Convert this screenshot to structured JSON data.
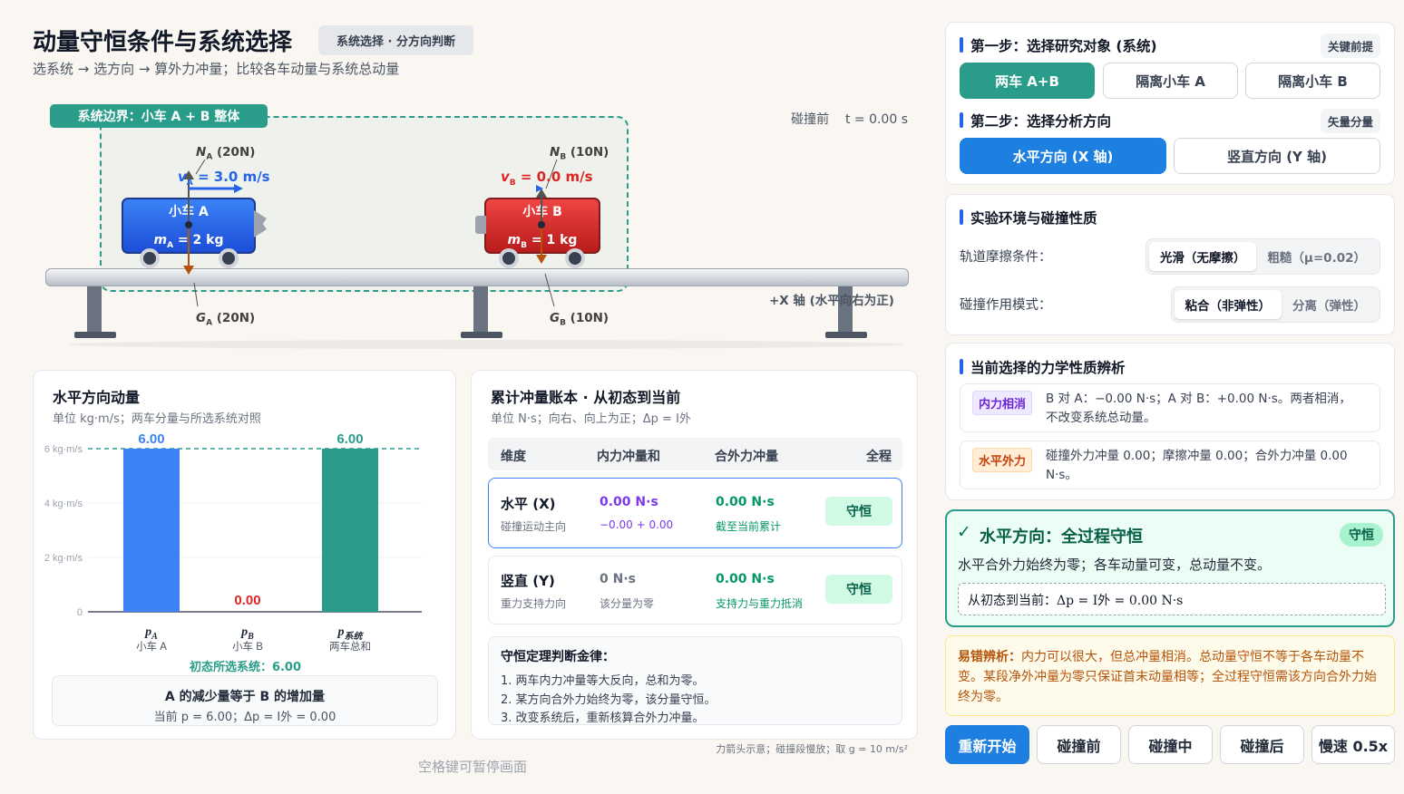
{
  "header": {
    "title": "动量守恒条件与系统选择",
    "tag": "系统选择 · 分方向判断",
    "subtitle": "选系统 → 选方向 → 算外力冲量；比较各车动量与系统总动量"
  },
  "scene": {
    "system_label": "系统边界：小车 A + B 整体",
    "status_phase": "碰撞前",
    "status_time": "t = 0.00 s",
    "cart_a": {
      "name": "小车 A",
      "mass_sym": "m",
      "mass_sub": "A",
      "mass_val": "= 2 kg",
      "vel_sym": "v",
      "vel_sub": "A",
      "vel_val": "= 3.0 m/s",
      "n_sym": "N",
      "n_sub": "A",
      "n_val": "(20N)",
      "g_sym": "G",
      "g_sub": "A",
      "g_val": "(20N)"
    },
    "cart_b": {
      "name": "小车 B",
      "mass_sym": "m",
      "mass_sub": "B",
      "mass_val": "= 1 kg",
      "vel_sym": "v",
      "vel_sub": "B",
      "vel_val": "= 0.0 m/s",
      "n_sym": "N",
      "n_sub": "B",
      "n_val": "(10N)",
      "g_sym": "G",
      "g_sub": "B",
      "g_val": "(10N)"
    },
    "axis_label": "+X 轴 (水平向右为正)"
  },
  "momentum": {
    "title": "水平方向动量",
    "subtitle": "单位 kg·m/s；两车分量与所选系统对照",
    "ref_note": "初态所选系统：6.00",
    "hint_title": "A 的减少量等于 B 的增加量",
    "hint_text": "当前 p = 6.00；Δp = I外 = 0.00",
    "chart_data": {
      "type": "bar",
      "categories": [
        {
          "sym": "p",
          "sub": "A",
          "desc": "小车 A"
        },
        {
          "sym": "p",
          "sub": "B",
          "desc": "小车 B"
        },
        {
          "sym": "p",
          "sub": "系统",
          "desc": "两车总和"
        }
      ],
      "values": [
        6.0,
        0.0,
        6.0
      ],
      "value_labels": [
        "6.00",
        "0.00",
        "6.00"
      ],
      "colors": [
        "#3b82f6",
        "#dc2626",
        "#2a9d8a"
      ],
      "y_ticks": [
        "0",
        "2 kg·m/s",
        "4 kg·m/s",
        "6 kg·m/s"
      ],
      "y_tick_values": [
        0,
        2,
        4,
        6
      ],
      "ylim": [
        0,
        6
      ],
      "reference_line": 6.0
    }
  },
  "ledger": {
    "title": "累计冲量账本 · 从初态到当前",
    "subtitle": "单位 N·s；向右、向上为正；Δp = I外",
    "headers": [
      "维度",
      "内力冲量和",
      "合外力冲量",
      "全程"
    ],
    "rows": [
      {
        "dim": "水平 (X)",
        "dim_note": "碰撞运动主向",
        "internal": "0.00 N·s",
        "internal_note": "−0.00 + 0.00",
        "external": "0.00 N·s",
        "external_note": "截至当前累计",
        "status": "守恒"
      },
      {
        "dim": "竖直 (Y)",
        "dim_note": "重力支持力向",
        "internal": "0 N·s",
        "internal_note": "该分量为零",
        "external": "0.00 N·s",
        "external_note": "支持力与重力抵消",
        "status": "守恒"
      }
    ],
    "rules_title": "守恒定理判断金律：",
    "rules": [
      "1. 两车内力冲量等大反向，总和为零。",
      "2. 某方向合外力始终为零，该分量守恒。",
      "3. 改变系统后，重新核算合外力冲量。"
    ],
    "footnote": "力箭头示意；碰撞段慢放；取 g = 10 m/s²"
  },
  "pause_hint": "空格键可暂停画面",
  "step1": {
    "title": "第一步：选择研究对象 (系统)",
    "chip": "关键前提",
    "options": [
      "两车 A+B",
      "隔离小车 A",
      "隔离小车 B"
    ]
  },
  "step2": {
    "title": "第二步：选择分析方向",
    "chip": "矢量分量",
    "options": [
      "水平方向 (X 轴)",
      "竖直方向 (Y 轴)"
    ]
  },
  "env": {
    "title": "实验环境与碰撞性质",
    "friction_label": "轨道摩擦条件：",
    "friction_options": [
      "光滑（无摩擦）",
      "粗糙（μ=0.02）"
    ],
    "collision_label": "碰撞作用模式：",
    "collision_options": [
      "粘合（非弹性）",
      "分离（弹性）"
    ]
  },
  "analysis": {
    "title": "当前选择的力学性质辨析",
    "items": [
      {
        "tag": "内力相消",
        "text": "B 对 A：−0.00 N·s；A 对 B：+0.00 N·s。两者相消，不改变系统总动量。"
      },
      {
        "tag": "水平外力",
        "text": "碰撞外力冲量 0.00；摩擦冲量 0.00；合外力冲量 0.00 N·s。"
      }
    ]
  },
  "verdict": {
    "title": "水平方向：全过程守恒",
    "badge": "守恒",
    "text": "水平合外力始终为零；各车动量可变，总动量不变。",
    "formula": "从初态到当前：Δp = I外 = 0.00 N·s"
  },
  "pitfall": {
    "label": "易错辨析：",
    "text": "内力可以很大，但总冲量相消。总动量守恒不等于各车动量不变。某段净外冲量为零只保证首末动量相等；全过程守恒需该方向合外力始终为零。"
  },
  "controls": [
    "重新开始",
    "碰撞前",
    "碰撞中",
    "碰撞后",
    "慢速 0.5x"
  ],
  "colors": {
    "primary": "#1d7fe0",
    "teal": "#2a9d8a",
    "cart_a": "#2563eb",
    "cart_b": "#dc2626",
    "conserved_bg": "#d1fae5"
  }
}
